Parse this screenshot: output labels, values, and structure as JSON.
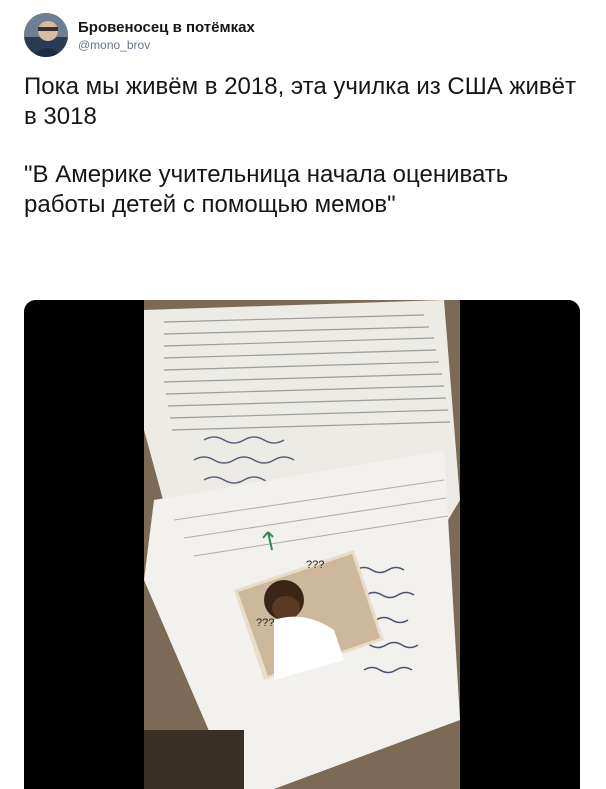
{
  "account": {
    "display_name": "Бровеносец в потёмках",
    "handle": "@mono_brov",
    "avatar_icon": "avatar-photo"
  },
  "tweet": {
    "line1": "Пока мы живём в 2018, эта училка из США живёт в 3018",
    "line2": "\"В Америке учительница начала оценивать работы детей с помощью мемов\""
  },
  "media": {
    "type": "video-still",
    "handwritten_notes": [
      "???",
      "???"
    ]
  },
  "colors": {
    "text": "#14171a",
    "muted": "#657786",
    "media_bg": "#000000"
  }
}
